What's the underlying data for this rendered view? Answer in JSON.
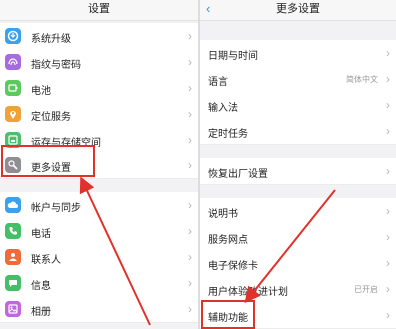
{
  "left": {
    "title": "设置",
    "items": [
      {
        "label": "系统升级",
        "icon": "system-update-icon",
        "color": "#3aa1f0"
      },
      {
        "label": "指纹与密码",
        "icon": "fingerprint-icon",
        "color": "#a76be0"
      },
      {
        "label": "电池",
        "icon": "battery-icon",
        "color": "#5cc95c"
      },
      {
        "label": "定位服务",
        "icon": "location-icon",
        "color": "#f0a23a"
      },
      {
        "label": "运存与存储空间",
        "icon": "storage-icon",
        "color": "#4cbf6c"
      },
      {
        "label": "更多设置",
        "icon": "wrench-icon",
        "color": "#8e8e93"
      },
      {
        "label": "帐户与同步",
        "icon": "cloud-icon",
        "color": "#3aa1f0"
      },
      {
        "label": "电话",
        "icon": "phone-icon",
        "color": "#43c066"
      },
      {
        "label": "联系人",
        "icon": "contacts-icon",
        "color": "#f06a3a"
      },
      {
        "label": "信息",
        "icon": "message-icon",
        "color": "#43c066"
      },
      {
        "label": "相册",
        "icon": "album-icon",
        "color": "#c465e0"
      }
    ]
  },
  "right": {
    "title": "更多设置",
    "back": "‹",
    "items": [
      {
        "label": "日期与时间",
        "value": ""
      },
      {
        "label": "语言",
        "value": "简体中文"
      },
      {
        "label": "输入法",
        "value": ""
      },
      {
        "label": "定时任务",
        "value": ""
      },
      {
        "label": "恢复出厂设置",
        "value": ""
      },
      {
        "label": "说明书",
        "value": ""
      },
      {
        "label": "服务网点",
        "value": ""
      },
      {
        "label": "电子保修卡",
        "value": ""
      },
      {
        "label": "用户体验改进计划",
        "value": "已开启"
      },
      {
        "label": "辅助功能",
        "value": ""
      }
    ]
  },
  "chevron": "›",
  "colors": {
    "highlight": "#e0322b",
    "accent": "#3a8be8"
  }
}
